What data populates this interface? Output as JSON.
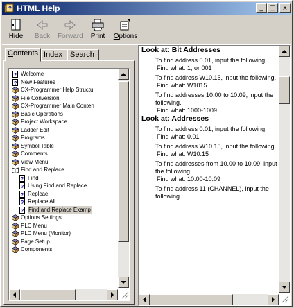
{
  "window": {
    "title": "HTML Help"
  },
  "titlebar_buttons": {
    "minimize": "_",
    "maximize": "□",
    "close": "x"
  },
  "toolbar": {
    "hide": "Hide",
    "back": "Back",
    "forward": "Forward",
    "print": "Print",
    "options": "Options"
  },
  "tabs": [
    {
      "pre": "",
      "u": "C",
      "post": "ontents"
    },
    {
      "pre": "",
      "u": "I",
      "post": "ndex"
    },
    {
      "pre": "",
      "u": "S",
      "post": "earch"
    }
  ],
  "tree": [
    {
      "label": "Welcome",
      "icon": "page",
      "indent": 0
    },
    {
      "label": "New Features",
      "icon": "page",
      "indent": 0
    },
    {
      "label": "CX-Programmer Help Structu",
      "icon": "book",
      "indent": 0
    },
    {
      "label": "File Conversion",
      "icon": "book",
      "indent": 0
    },
    {
      "label": "CX-Programmer Main Conten",
      "icon": "book",
      "indent": 0
    },
    {
      "label": "Basic Operations",
      "icon": "book",
      "indent": 0
    },
    {
      "label": "Project Workspace",
      "icon": "book",
      "indent": 0
    },
    {
      "label": "Ladder Edit",
      "icon": "book",
      "indent": 0
    },
    {
      "label": "Programs",
      "icon": "book",
      "indent": 0
    },
    {
      "label": "Symbol Table",
      "icon": "book",
      "indent": 0
    },
    {
      "label": "Comments",
      "icon": "book",
      "indent": 0
    },
    {
      "label": "View Menu",
      "icon": "book",
      "indent": 0
    },
    {
      "label": "Find and Replace",
      "icon": "open-book",
      "indent": 0
    },
    {
      "label": "Find",
      "icon": "page",
      "indent": 1
    },
    {
      "label": "Using Find and Replace",
      "icon": "page",
      "indent": 1
    },
    {
      "label": "Replcae",
      "icon": "page",
      "indent": 1
    },
    {
      "label": "Replace All",
      "icon": "page",
      "indent": 1
    },
    {
      "label": "Find and Replace Examp",
      "icon": "page",
      "indent": 1,
      "selected": true
    },
    {
      "label": "Options Settings",
      "icon": "book",
      "indent": 0
    },
    {
      "label": "PLC Menu",
      "icon": "book",
      "indent": 0
    },
    {
      "label": "PLC Menu (Monitor)",
      "icon": "book",
      "indent": 0
    },
    {
      "label": "Page Setup",
      "icon": "book",
      "indent": 0
    },
    {
      "label": "Components",
      "icon": "book",
      "indent": 0
    }
  ],
  "content": [
    {
      "type": "h",
      "text": "Look at: Bit Addresses"
    },
    {
      "type": "p",
      "text": "To find address 0.01, input the following."
    },
    {
      "type": "f",
      "text": "Find what: 1, or 001"
    },
    {
      "type": "p",
      "text": "To find address W10.15, input the following."
    },
    {
      "type": "f",
      "text": "Find what: W1015"
    },
    {
      "type": "p",
      "text": "To find addresses 10.00 to 10.09, input the following."
    },
    {
      "type": "f",
      "text": "Find what: 1000-1009"
    },
    {
      "type": "h",
      "text": "Look at: Addresses"
    },
    {
      "type": "p",
      "text": "To find address 0.01, input the following."
    },
    {
      "type": "f",
      "text": "Find what: 0.01"
    },
    {
      "type": "p",
      "text": "To find address W10.15, input the following."
    },
    {
      "type": "f",
      "text": "Find what: W10.15"
    },
    {
      "type": "p",
      "text": "To find addresses from 10.00 to 10.09, input the following."
    },
    {
      "type": "f",
      "text": "Find what: 10.00-10.09"
    },
    {
      "type": "p",
      "text": "To find address 11 (CHANNEL), input the following."
    }
  ],
  "colors": {
    "titlebar_start": "#0a246a",
    "titlebar_end": "#a6caf0",
    "face": "#d4d0c8"
  }
}
